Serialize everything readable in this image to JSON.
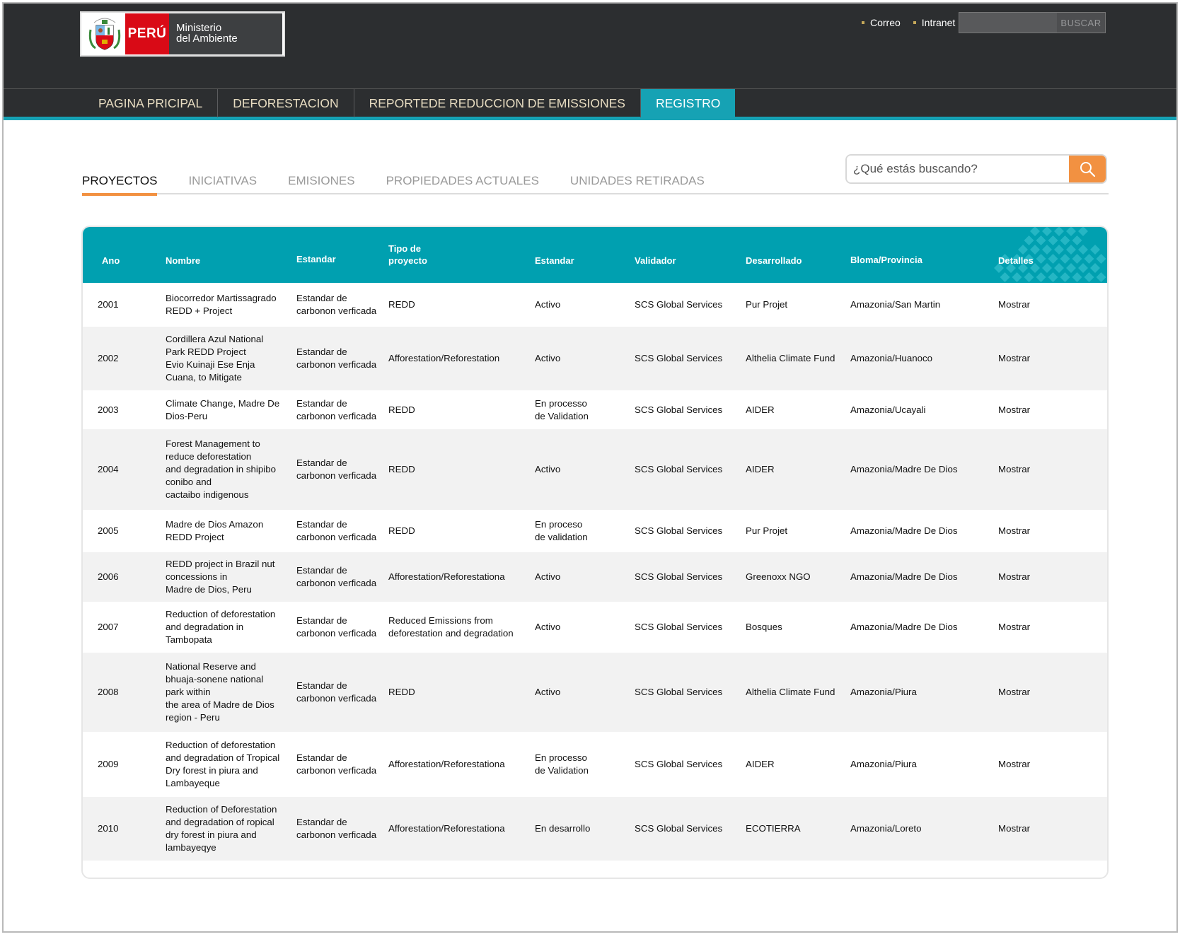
{
  "header": {
    "logo": {
      "country": "PERÚ",
      "ministry_line1": "Ministerio",
      "ministry_line2": "del Ambiente"
    },
    "links": [
      "Correo",
      "Intranet"
    ],
    "search_button": "BUSCAR"
  },
  "nav": {
    "items": [
      "PAGINA PRICIPAL",
      "DEFORESTACION",
      "REPORTEDE REDUCCION DE EMISSIONES",
      "REGISTRO"
    ],
    "active": "REGISTRO"
  },
  "tabs": {
    "items": [
      "PROYECTOS",
      "INICIATIVAS",
      "EMISIONES",
      "PROPIEDADES ACTUALES",
      "UNIDADES RETIRADAS"
    ],
    "active": "PROYECTOS"
  },
  "search": {
    "placeholder": "¿Qué estás buscando?"
  },
  "table": {
    "headers": {
      "ano": "Ano",
      "nombre": "Nombre",
      "estandar1": "Estandar",
      "tipo": "Tipo de\nproyecto",
      "estandar2": "Estandar",
      "validador": "Validador",
      "desarrollado": "Desarrollado",
      "bioma": "Bloma/Provincia",
      "detalles": "Detalles"
    },
    "rows": [
      {
        "ano": "2001",
        "nombre": "Biocorredor Martissagrado\nREDD + Project",
        "estandar1": "Estandar de\ncarbonon verficada",
        "tipo": "REDD",
        "estandar2": "Activo",
        "validador": "SCS Global Services",
        "desarrollado": "Pur Projet",
        "bioma": "Amazonia/San Martin",
        "detalles": "Mostrar"
      },
      {
        "ano": "2002",
        "nombre": "Cordillera Azul National\nPark REDD Project\nEvio Kuinaji Ese Enja\nCuana, to Mitigate",
        "estandar1": "Estandar de\ncarbonon verficada",
        "tipo": "Afforestation/Reforestation",
        "estandar2": "Activo",
        "validador": "SCS Global Services",
        "desarrollado": "Althelia Climate Fund",
        "bioma": "Amazonia/Huanoco",
        "detalles": "Mostrar"
      },
      {
        "ano": "2003",
        "nombre": "Climate Change, Madre De\nDios-Peru",
        "estandar1": "Estandar de\ncarbonon verficada",
        "tipo": "REDD",
        "estandar2": "En processo\nde Validation",
        "validador": "SCS Global Services",
        "desarrollado": "AIDER",
        "bioma": "Amazonia/Ucayali",
        "detalles": "Mostrar"
      },
      {
        "ano": "2004",
        "nombre": "Forest Management to\nreduce deforestation\nand degradation in shipibo\nconibo and\ncactaibo indigenous",
        "estandar1": "Estandar de\ncarbonon verficada",
        "tipo": "REDD",
        "estandar2": "Activo",
        "validador": "SCS Global Services",
        "desarrollado": "AIDER",
        "bioma": "Amazonia/Madre De Dios",
        "detalles": "Mostrar"
      },
      {
        "ano": "2005",
        "nombre": "Madre de Dios Amazon\nREDD Project",
        "estandar1": "Estandar de\ncarbonon verficada",
        "tipo": "REDD",
        "estandar2": "En proceso\n de validation",
        "validador": "SCS Global Services",
        "desarrollado": "Pur Projet",
        "bioma": "Amazonia/Madre De Dios",
        "detalles": "Mostrar"
      },
      {
        "ano": "2006",
        "nombre": "REDD project in Brazil nut\nconcessions in\nMadre de Dios, Peru",
        "estandar1": "Estandar de\ncarbonon verficada",
        "tipo": "Afforestation/Reforestationa",
        "estandar2": "Activo",
        "validador": "SCS Global Services",
        "desarrollado": "Greenoxx NGO",
        "bioma": "Amazonia/Madre De Dios",
        "detalles": "Mostrar"
      },
      {
        "ano": "2007",
        "nombre": "Reduction of deforestation\nand degradation in\nTambopata",
        "estandar1": "Estandar de\ncarbonon verficada",
        "tipo": "Reduced Emissions from\ndeforestation and degradation",
        "estandar2": "Activo",
        "validador": "SCS Global Services",
        "desarrollado": "Bosques",
        "bioma": "Amazonia/Madre De Dios",
        "detalles": "Mostrar"
      },
      {
        "ano": "2008",
        "nombre": "National Reserve and\nbhuaja-sonene national\npark within\nthe area of Madre de Dios\nregion - Peru",
        "estandar1": "Estandar de\ncarbonon verficada",
        "tipo": "REDD",
        "estandar2": "Activo",
        "validador": "SCS Global Services",
        "desarrollado": "Althelia Climate Fund",
        "bioma": "Amazonia/Piura",
        "detalles": "Mostrar"
      },
      {
        "ano": "2009",
        "nombre": "Reduction of deforestation\nand degradation of Tropical\nDry forest in piura and\nLambayeque",
        "estandar1": "Estandar de\ncarbonon verficada",
        "tipo": "Afforestation/Reforestationa",
        "estandar2": "En processo\nde Validation",
        "validador": "SCS Global Services",
        "desarrollado": "AIDER",
        "bioma": "Amazonia/Piura",
        "detalles": "Mostrar"
      },
      {
        "ano": "2010",
        "nombre": "Reduction of Deforestation\nand degradation of ropical\ndry forest in piura and\nlambayeqye",
        "estandar1": "Estandar de\ncarbonon verficada",
        "tipo": "Afforestation/Reforestationa",
        "estandar2": "En desarrollo",
        "validador": "SCS Global Services",
        "desarrollado": "ECOTIERRA",
        "bioma": "Amazonia/Loreto",
        "detalles": "Mostrar"
      }
    ]
  },
  "colors": {
    "accent": "#16a2b4",
    "header_bg": "#2c2e30",
    "tab_underline": "#f29141",
    "table_header": "#00a0b0",
    "logo_red": "#d90a16"
  }
}
